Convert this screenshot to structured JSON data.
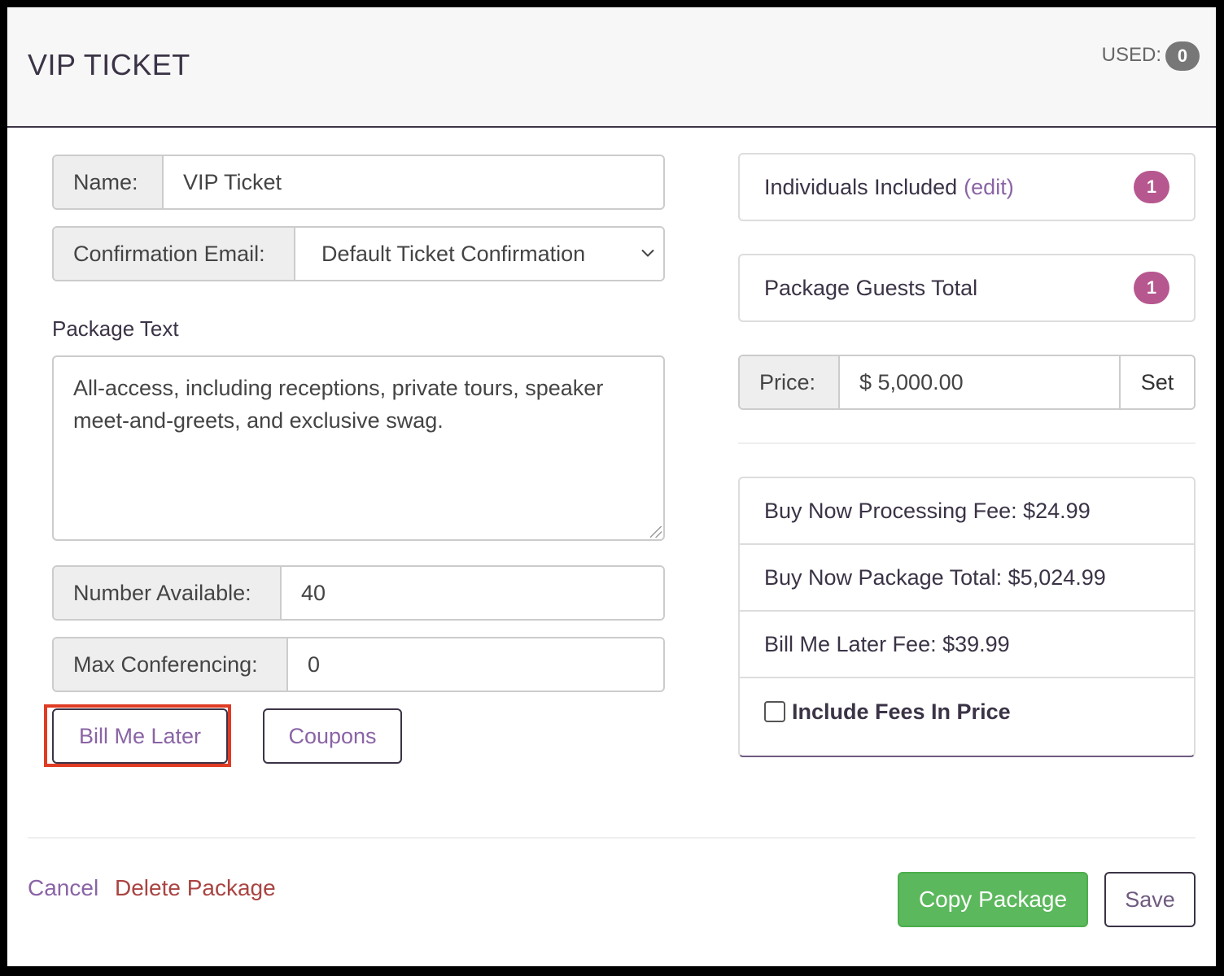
{
  "header": {
    "title": "VIP TICKET",
    "used_label": "USED:",
    "used_count": "0"
  },
  "form": {
    "name_label": "Name:",
    "name_value": "VIP Ticket",
    "email_label": "Confirmation Email:",
    "email_value": "Default Ticket Confirmation",
    "package_text_label": "Package Text",
    "package_text_line1": "All-access, including receptions, private tours, speaker",
    "package_text_line2": "meet-and-greets, and exclusive swag.",
    "number_available_label": "Number Available:",
    "number_available_value": "40",
    "max_conferencing_label": "Max Conferencing:",
    "max_conferencing_value": "0",
    "bill_me_later_button": "Bill Me Later",
    "coupons_button": "Coupons"
  },
  "side": {
    "individuals_label": "Individuals Included",
    "individuals_edit": "(edit)",
    "individuals_count": "1",
    "guests_label": "Package Guests Total",
    "guests_count": "1",
    "price_label": "Price:",
    "price_value": "$ 5,000.00",
    "set_button": "Set",
    "fee_processing": "Buy Now Processing Fee: $24.99",
    "fee_total": "Buy Now Package Total: $5,024.99",
    "fee_bill_later": "Bill Me Later Fee: $39.99",
    "include_fees_label": "Include Fees In Price",
    "include_fees_checked": false
  },
  "footer": {
    "cancel": "Cancel",
    "delete": "Delete Package",
    "copy": "Copy Package",
    "save": "Save"
  },
  "colors": {
    "accent_purple": "#8a64a5",
    "danger_red": "#a94442",
    "success_green": "#5cb85c",
    "badge_pink": "#b7578f",
    "highlight_red": "#e03b24"
  }
}
